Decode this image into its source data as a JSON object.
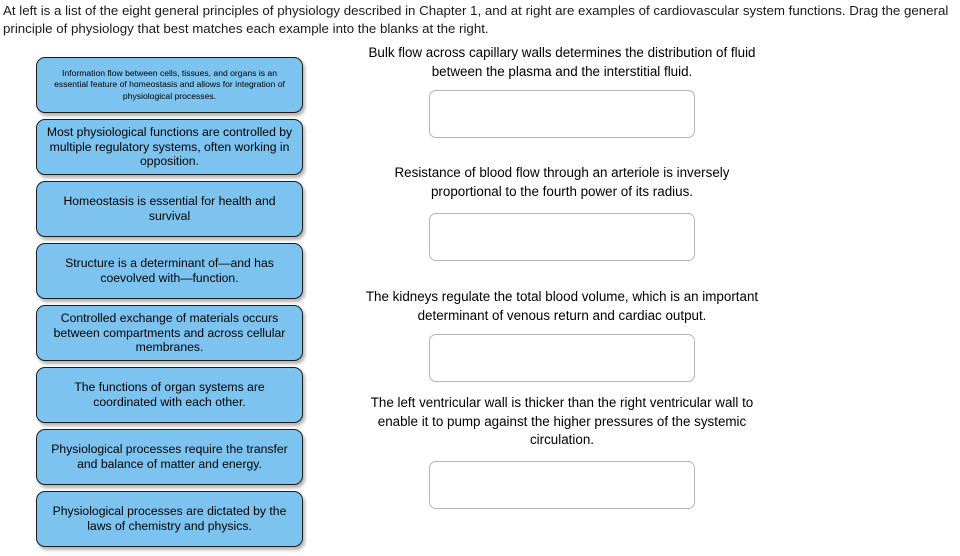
{
  "instructions": {
    "text": "At left is a list of the eight general principles of physiology described in Chapter 1, and at right are examples of cardiovascular system functions. Drag the general principle of physiology that best matches each example into the blanks at the right."
  },
  "colors": {
    "tile_fill": "#7cc3f0",
    "tile_border": "#1c1c1c",
    "drop_zone_border": "#b5b5b5",
    "page_background": "#ffffff",
    "text": "#000000"
  },
  "principles": {
    "items": [
      {
        "label": "Information flow between cells, tissues, and organs is an essential feature of homeostasis and allows for integration of physiological processes."
      },
      {
        "label": "Most physiological functions are controlled by multiple regulatory systems, often working in opposition."
      },
      {
        "label": "Homeostasis is essential for health and survival"
      },
      {
        "label": "Structure is a determinant of—and has coevolved with—function."
      },
      {
        "label": "Controlled exchange of materials occurs between compartments and across cellular membranes."
      },
      {
        "label": "The functions of organ systems are coordinated with each other."
      },
      {
        "label": "Physiological processes require the transfer and balance of matter and energy."
      },
      {
        "label": "Physiological processes are dictated by the laws of chemistry and physics."
      }
    ]
  },
  "examples": {
    "items": [
      {
        "prompt": "Bulk flow across capillary walls determines the distribution of fluid between the plasma and the interstitial fluid.",
        "answer": ""
      },
      {
        "prompt": "Resistance of blood flow through an arteriole is inversely proportional to the fourth power of its radius.",
        "answer": ""
      },
      {
        "prompt": "The kidneys regulate the total blood volume, which is an important determinant of venous return and cardiac output.",
        "answer": ""
      },
      {
        "prompt": "The left ventricular wall is thicker than the right ventricular wall to enable it to pump against the higher pressures of the systemic circulation.",
        "answer": ""
      }
    ]
  }
}
